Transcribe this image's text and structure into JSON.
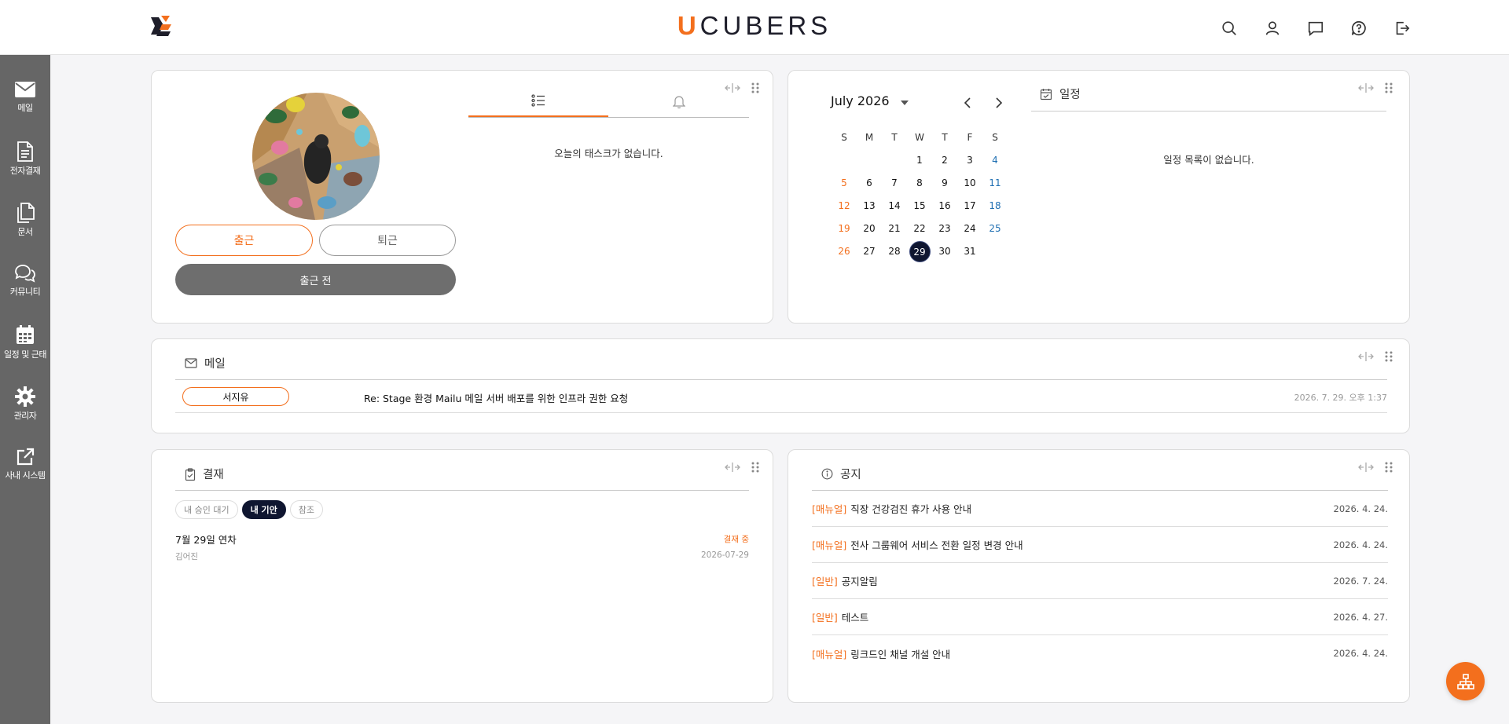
{
  "header": {
    "brand_first": "U",
    "brand_rest": "CUBERS",
    "icons": [
      "search-icon",
      "user-icon",
      "chat-icon",
      "help-icon",
      "logout-icon"
    ]
  },
  "sidebar": {
    "items": [
      {
        "label": "메일",
        "icon": "mail-icon"
      },
      {
        "label": "전자결재",
        "icon": "document-icon"
      },
      {
        "label": "문서",
        "icon": "files-icon"
      },
      {
        "label": "커뮤니티",
        "icon": "chat-bubbles-icon"
      },
      {
        "label": "일정 및 근태",
        "icon": "calendar-icon"
      },
      {
        "label": "관리자",
        "icon": "gear-icon"
      },
      {
        "label": "사내 시스템",
        "icon": "external-link-icon"
      }
    ]
  },
  "profile": {
    "clock_in_label": "출근",
    "clock_out_label": "퇴근",
    "status_label": "출근 전",
    "tasks_empty": "오늘의 태스크가 없습니다."
  },
  "calendar": {
    "month_label": "July 2026",
    "weekdays": [
      "S",
      "M",
      "T",
      "W",
      "T",
      "F",
      "S"
    ],
    "weeks": [
      [
        "",
        "",
        "",
        "1",
        "2",
        "3",
        "4"
      ],
      [
        "5",
        "6",
        "7",
        "8",
        "9",
        "10",
        "11"
      ],
      [
        "12",
        "13",
        "14",
        "15",
        "16",
        "17",
        "18"
      ],
      [
        "19",
        "20",
        "21",
        "22",
        "23",
        "24",
        "25"
      ],
      [
        "26",
        "27",
        "28",
        "29",
        "30",
        "31",
        ""
      ]
    ],
    "today": "29",
    "schedule_title": "일정",
    "schedule_empty": "일정 목록이 없습니다."
  },
  "mail": {
    "title": "메일",
    "items": [
      {
        "sender": "서지유",
        "subject": "Re: Stage 환경 Mailu 메일 서버 배포를 위한 인프라 권한 요청",
        "date": "2026. 7. 29. 오후 1:37"
      }
    ]
  },
  "approval": {
    "title": "결재",
    "tabs": [
      "내 승인 대기",
      "내 기안",
      "참조"
    ],
    "active_tab": "내 기안",
    "items": [
      {
        "title": "7월 29일 연차",
        "status": "결재 중",
        "author": "김어진",
        "date": "2026-07-29"
      }
    ]
  },
  "notice": {
    "title": "공지",
    "items": [
      {
        "category": "[매뉴얼]",
        "title": "직장 건강검진 휴가 사용 안내",
        "date": "2026. 4. 24."
      },
      {
        "category": "[매뉴얼]",
        "title": "전사 그룹웨어 서비스 전환 일정 변경 안내",
        "date": "2026. 4. 24."
      },
      {
        "category": "[일반]",
        "title": "공지알림",
        "date": "2026. 7. 24."
      },
      {
        "category": "[일반]",
        "title": "테스트",
        "date": "2026. 4. 27."
      },
      {
        "category": "[매뉴얼]",
        "title": "링크드인 채널 개설 안내",
        "date": "2026. 4. 24."
      }
    ]
  },
  "colors": {
    "accent": "#f36f1d",
    "sidebar": "#666666",
    "today": "#0f1630"
  }
}
